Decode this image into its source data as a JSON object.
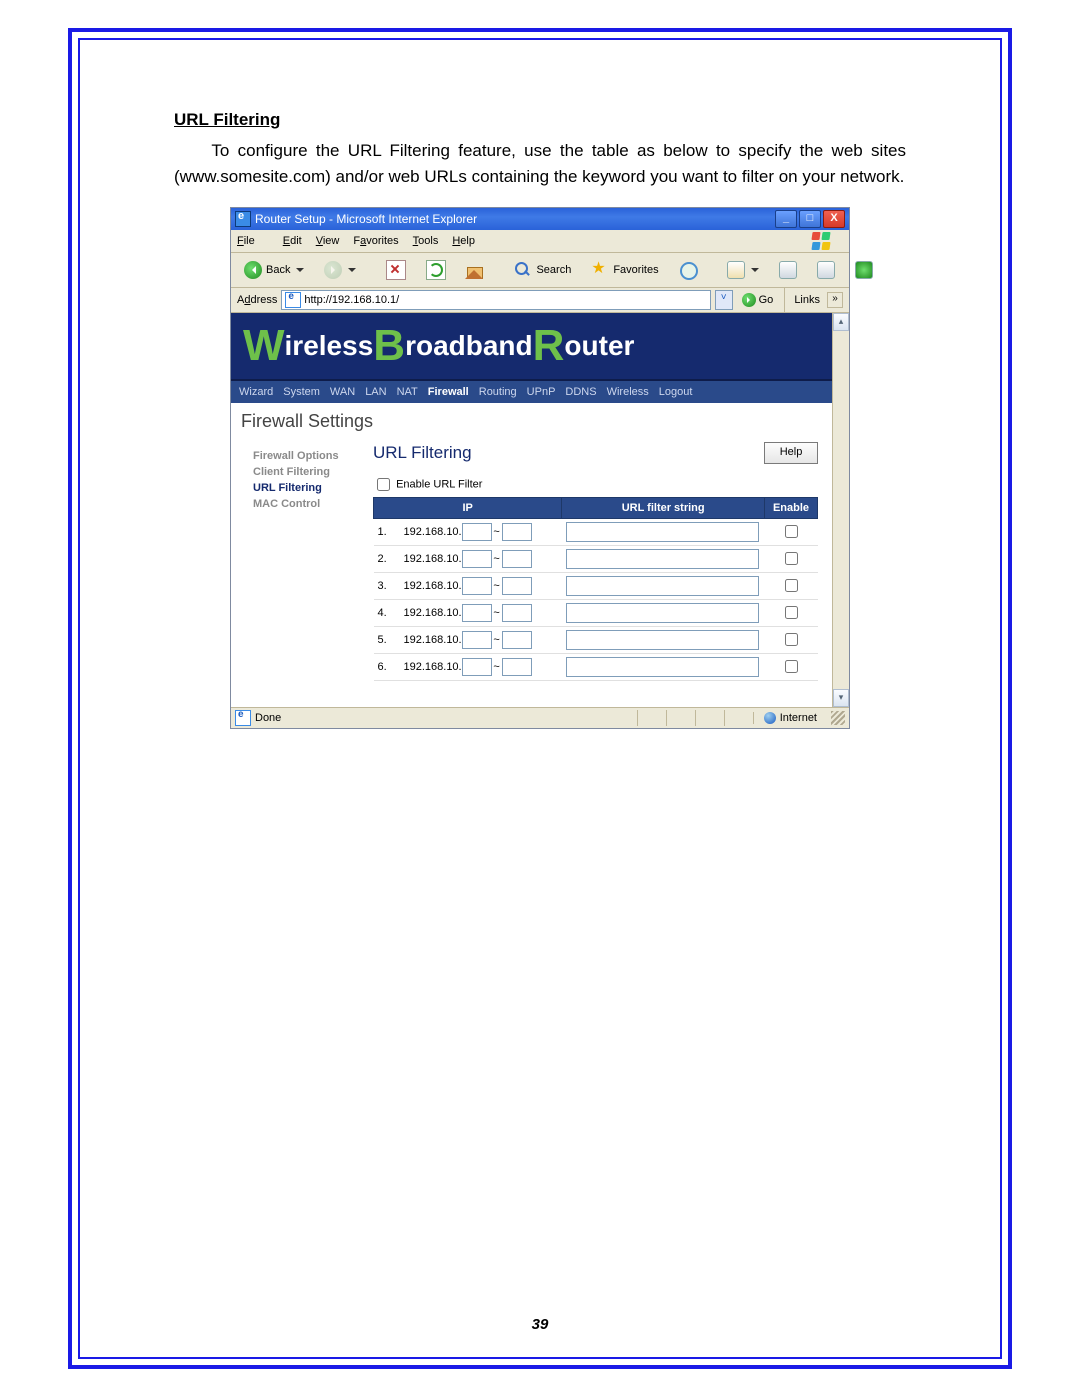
{
  "doc": {
    "heading": "URL Filtering",
    "paragraph": "To configure the URL Filtering feature, use the table as below to specify the web sites (www.somesite.com) and/or web URLs containing the keyword you want to filter on your network.",
    "page_number": "39"
  },
  "window": {
    "title": "Router Setup - Microsoft Internet Explorer",
    "btn_min": "_",
    "btn_max": "□",
    "btn_close": "X"
  },
  "menu": {
    "file": "File",
    "edit": "Edit",
    "view": "View",
    "fav": "Favorites",
    "tools": "Tools",
    "help": "Help"
  },
  "toolbar": {
    "back": "Back",
    "search": "Search",
    "favorites": "Favorites"
  },
  "address": {
    "label": "Address",
    "url": "http://192.168.10.1/",
    "go": "Go",
    "links": "Links"
  },
  "banner": {
    "w": "W",
    "ireless": "ireless ",
    "b": "B",
    "roadband": "roadband ",
    "r": "R",
    "outer": "outer"
  },
  "nav": [
    "Wizard",
    "System",
    "WAN",
    "LAN",
    "NAT",
    "Firewall",
    "Routing",
    "UPnP",
    "DDNS",
    "Wireless",
    "Logout"
  ],
  "nav_active": "Firewall",
  "page_title": "Firewall Settings",
  "sidebar": [
    {
      "label": "Firewall Options"
    },
    {
      "label": "Client Filtering"
    },
    {
      "label": "URL Filtering",
      "active": true
    },
    {
      "label": "MAC Control"
    }
  ],
  "main": {
    "title": "URL Filtering",
    "help": "Help",
    "enable_label": "Enable URL Filter",
    "cols": {
      "ip": "IP",
      "url": "URL filter string",
      "enable": "Enable"
    },
    "ip_prefix": "192.168.10.",
    "rows": [
      "1.",
      "2.",
      "3.",
      "4.",
      "5.",
      "6."
    ]
  },
  "status": {
    "done": "Done",
    "zone": "Internet"
  }
}
